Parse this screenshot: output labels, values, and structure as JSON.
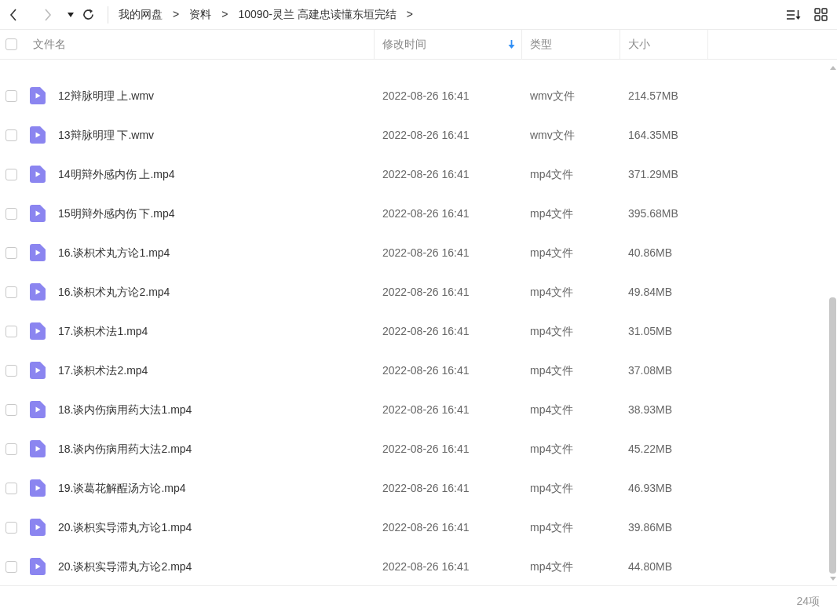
{
  "toolbar": {
    "breadcrumbs": [
      "我的网盘",
      "资料",
      "10090-灵兰 高建忠读懂东垣完结"
    ],
    "separator": ">"
  },
  "table": {
    "select_all_checked": false,
    "columns": [
      {
        "label": "文件名",
        "sorted": false
      },
      {
        "label": "修改时间",
        "sorted": true
      },
      {
        "label": "类型",
        "sorted": false
      },
      {
        "label": "大小",
        "sorted": false
      }
    ],
    "rows": [
      {
        "name": "12辩脉明理 上.wmv",
        "modified": "2022-08-26 16:41",
        "type": "wmv文件",
        "size": "214.57MB",
        "checked": false
      },
      {
        "name": "13辩脉明理 下.wmv",
        "modified": "2022-08-26 16:41",
        "type": "wmv文件",
        "size": "164.35MB",
        "checked": false
      },
      {
        "name": "14明辩外感内伤 上.mp4",
        "modified": "2022-08-26 16:41",
        "type": "mp4文件",
        "size": "371.29MB",
        "checked": false
      },
      {
        "name": "15明辩外感内伤 下.mp4",
        "modified": "2022-08-26 16:41",
        "type": "mp4文件",
        "size": "395.68MB",
        "checked": false
      },
      {
        "name": "16.谈枳术丸方论1.mp4",
        "modified": "2022-08-26 16:41",
        "type": "mp4文件",
        "size": "40.86MB",
        "checked": false
      },
      {
        "name": "16.谈枳术丸方论2.mp4",
        "modified": "2022-08-26 16:41",
        "type": "mp4文件",
        "size": "49.84MB",
        "checked": false
      },
      {
        "name": "17.谈枳术法1.mp4",
        "modified": "2022-08-26 16:41",
        "type": "mp4文件",
        "size": "31.05MB",
        "checked": false
      },
      {
        "name": "17.谈枳术法2.mp4",
        "modified": "2022-08-26 16:41",
        "type": "mp4文件",
        "size": "37.08MB",
        "checked": false
      },
      {
        "name": "18.谈内伤病用药大法1.mp4",
        "modified": "2022-08-26 16:41",
        "type": "mp4文件",
        "size": "38.93MB",
        "checked": false
      },
      {
        "name": "18.谈内伤病用药大法2.mp4",
        "modified": "2022-08-26 16:41",
        "type": "mp4文件",
        "size": "45.22MB",
        "checked": false
      },
      {
        "name": "19.谈葛花解酲汤方论.mp4",
        "modified": "2022-08-26 16:41",
        "type": "mp4文件",
        "size": "46.93MB",
        "checked": false
      },
      {
        "name": "20.谈枳实导滞丸方论1.mp4",
        "modified": "2022-08-26 16:41",
        "type": "mp4文件",
        "size": "39.86MB",
        "checked": false
      },
      {
        "name": "20.谈枳实导滞丸方论2.mp4",
        "modified": "2022-08-26 16:41",
        "type": "mp4文件",
        "size": "44.80MB",
        "checked": false
      }
    ]
  },
  "status_bar": {
    "count": "24项"
  }
}
